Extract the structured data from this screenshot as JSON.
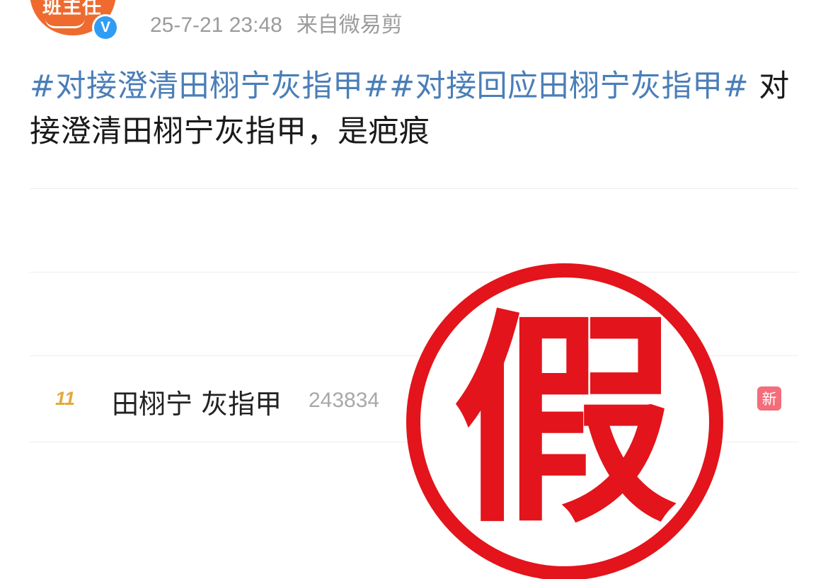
{
  "post": {
    "avatar_text": "班主任",
    "verified_icon_text": "V",
    "timestamp": "25-7-21 23:48",
    "source": "来自微易剪",
    "topic_1": "#对接澄清田栩宁灰指甲#",
    "topic_2": "#对接回应田栩宁灰指甲#",
    "body_text": " 对接澄清田栩宁灰指甲，是疤痕"
  },
  "image": {
    "rank": "11",
    "trend_title": "田栩宁 灰指甲",
    "trend_count": "243834",
    "new_badge": "新",
    "stamp_text": "假"
  },
  "colors": {
    "topic": "#4a7eb8",
    "stamp": "#e3141b",
    "new_badge": "#f36d7a",
    "verified": "#2f9df4",
    "avatar": "#ef6a2e"
  }
}
